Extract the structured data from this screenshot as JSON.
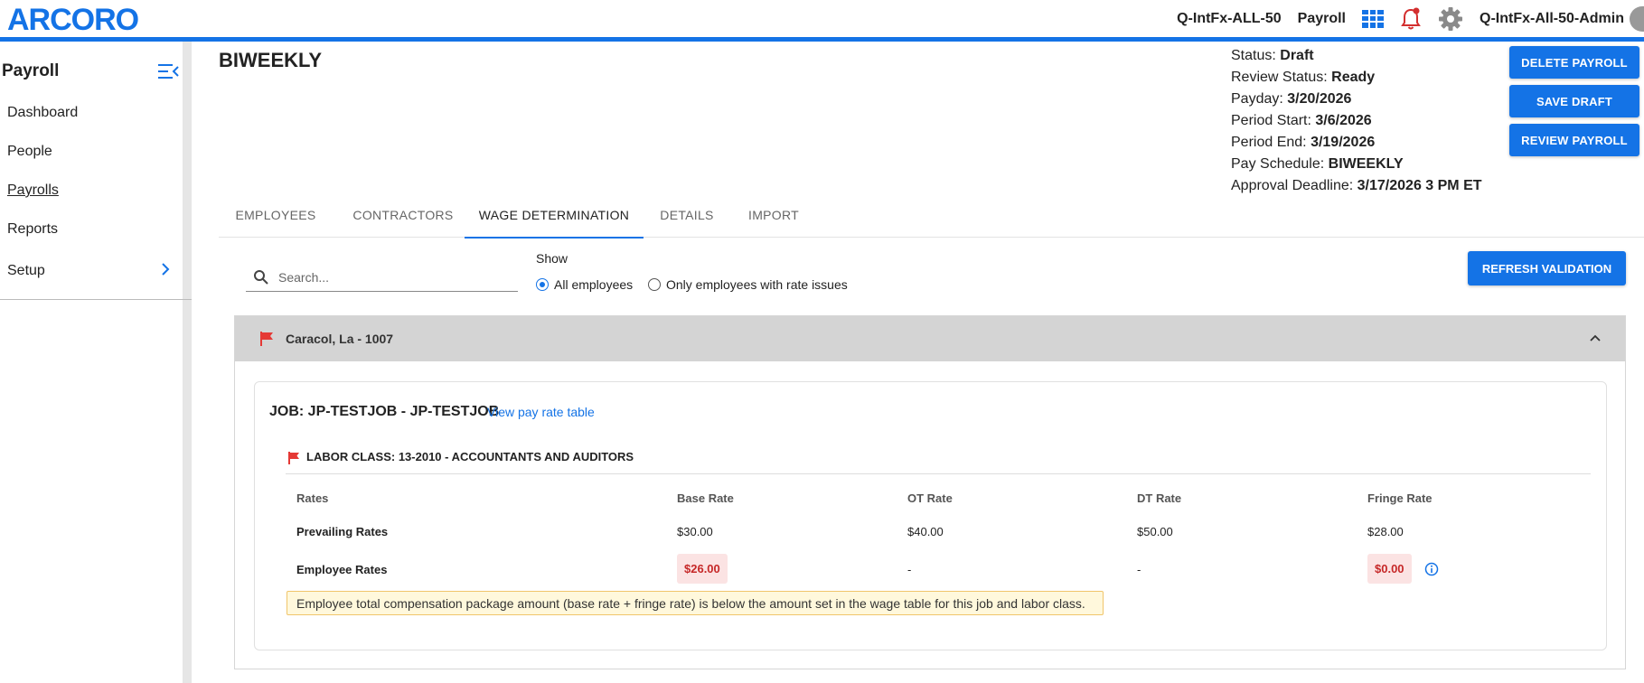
{
  "brand": {
    "logo_text": "ARCORO",
    "accent": "#1473e6"
  },
  "topbar": {
    "company": "Q-IntFx-ALL-50",
    "module": "Payroll",
    "user": "Q-IntFx-All-50-Admin",
    "icons": [
      "apps-grid-icon",
      "bell-icon",
      "gear-icon"
    ]
  },
  "sidebar": {
    "title": "Payroll",
    "items": [
      {
        "label": "Dashboard"
      },
      {
        "label": "People"
      },
      {
        "label": "Payrolls",
        "active": true
      },
      {
        "label": "Reports"
      },
      {
        "label": "Setup",
        "has_submenu": true
      }
    ]
  },
  "page": {
    "title": "BIWEEKLY"
  },
  "status": {
    "status_label": "Status:",
    "status_value": "Draft",
    "review_label": "Review Status:",
    "review_value": "Ready",
    "payday_label": "Payday:",
    "payday_value": "3/20/2026",
    "period_start_label": "Period Start:",
    "period_start_value": "3/6/2026",
    "period_end_label": "Period End:",
    "period_end_value": "3/19/2026",
    "schedule_label": "Pay Schedule:",
    "schedule_value": "BIWEEKLY",
    "deadline_label": "Approval Deadline:",
    "deadline_value": "3/17/2026 3 PM ET"
  },
  "actions": {
    "delete": "DELETE PAYROLL",
    "save": "SAVE DRAFT",
    "review": "REVIEW PAYROLL"
  },
  "tabs": [
    {
      "label": "EMPLOYEES"
    },
    {
      "label": "CONTRACTORS"
    },
    {
      "label": "WAGE DETERMINATION",
      "active": true
    },
    {
      "label": "DETAILS"
    },
    {
      "label": "IMPORT"
    }
  ],
  "filter": {
    "search_placeholder": "Search...",
    "show_label": "Show",
    "option_all": "All employees",
    "option_issues": "Only employees with rate issues",
    "selected": "all",
    "refresh_button": "REFRESH VALIDATION"
  },
  "employee": {
    "name": "Caracol, La - 1007",
    "flag_color": "#e53935",
    "job": {
      "title": "JOB: JP-TESTJOB - JP-TESTJOB",
      "link": "View pay rate table",
      "labor_class": "LABOR CLASS: 13-2010 - ACCOUNTANTS AND AUDITORS",
      "columns": [
        "Rates",
        "Base Rate",
        "OT Rate",
        "DT Rate",
        "Fringe Rate"
      ],
      "rows": [
        {
          "label": "Prevailing Rates",
          "base": "$30.00",
          "ot": "$40.00",
          "dt": "$50.00",
          "fringe": "$28.00"
        },
        {
          "label": "Employee Rates",
          "base": "$26.00",
          "ot": "-",
          "dt": "-",
          "fringe": "$0.00",
          "base_error": true,
          "fringe_error": true
        }
      ],
      "warning": "Employee total compensation package amount (base rate + fringe rate) is below the amount set in the wage table for this job and labor class."
    }
  }
}
